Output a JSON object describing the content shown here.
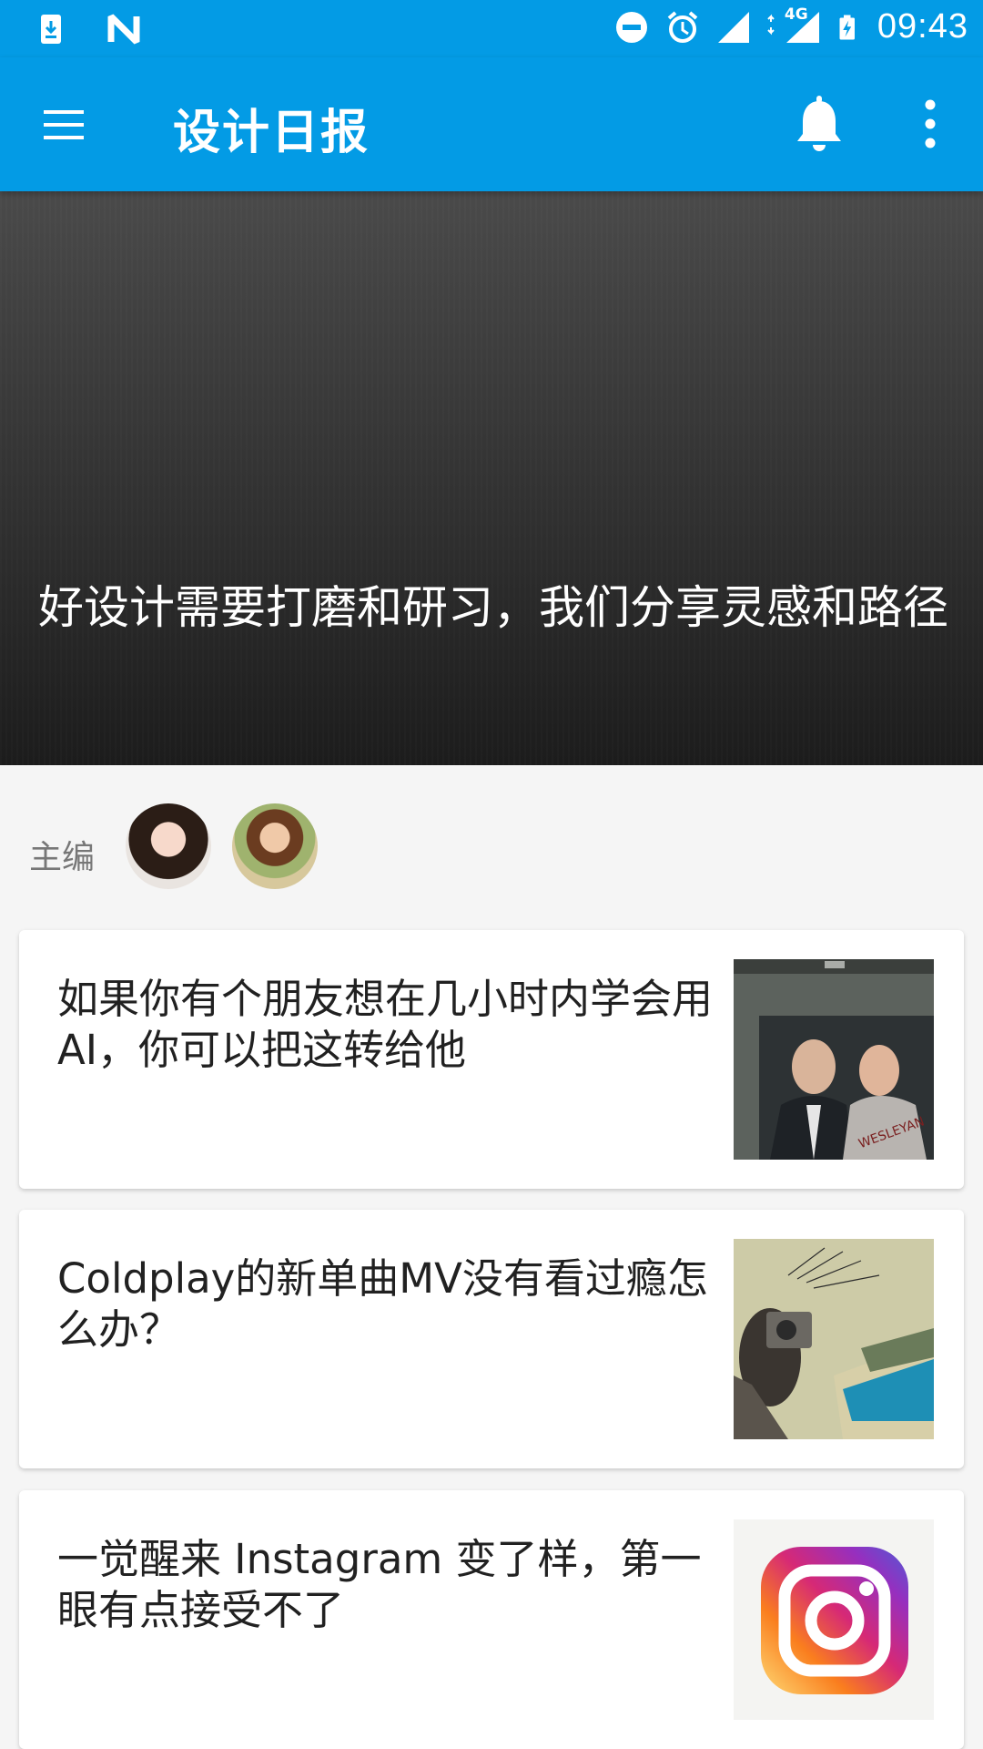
{
  "status_bar": {
    "time": "09:43",
    "network_label": "4G"
  },
  "toolbar": {
    "title": "设计日报"
  },
  "hero": {
    "title": "好设计需要打磨和研习，我们分享灵感和路径"
  },
  "editors": {
    "label": "主编"
  },
  "articles": [
    {
      "title": "如果你有个朋友想在几小时内学会用 AI，你可以把这转给他"
    },
    {
      "title": "Coldplay的新单曲MV没有看过瘾怎么办？"
    },
    {
      "title": "一觉醒来 Instagram 变了样，第一眼有点接受不了"
    }
  ],
  "colors": {
    "primary": "#039be5",
    "hero_dark": "#1c1c1c",
    "background": "#f5f5f5"
  }
}
